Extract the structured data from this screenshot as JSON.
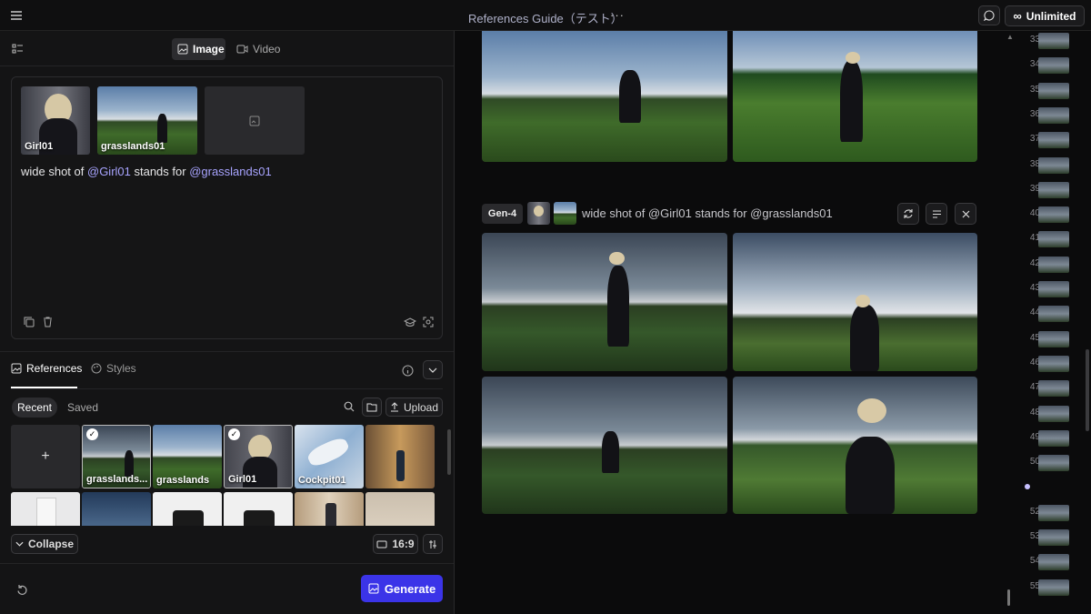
{
  "header": {
    "title": "References Guide（テスト）",
    "more_label": "···",
    "plan_label": "Unlimited"
  },
  "mode_tabs": [
    {
      "label": "Image",
      "active": true
    },
    {
      "label": "Video",
      "active": false
    }
  ],
  "prompt": {
    "attachments": [
      "Girl01",
      "grasslands01"
    ],
    "text_before": "wide shot of ",
    "mention1": "@Girl01",
    "text_middle": " stands for ",
    "mention2": "@grasslands01"
  },
  "refs_panel": {
    "tabs": [
      "References",
      "Styles"
    ],
    "filters": [
      "Recent",
      "Saved"
    ],
    "upload_label": "Upload",
    "add_label": "+",
    "grid_row1": [
      {
        "label": "grasslands...",
        "checked": true
      },
      {
        "label": "grasslands",
        "checked": false
      },
      {
        "label": "Girl01",
        "checked": true
      },
      {
        "label": "Cockpit01",
        "checked": false
      },
      {
        "label": "",
        "checked": false
      }
    ],
    "collapse_label": "Collapse",
    "ratio_label": "16:9",
    "generate_label": "Generate"
  },
  "generation": {
    "model_badge": "Gen-4",
    "prompt_text": "wide shot of @Girl01 stands for @grasslands01"
  },
  "timeline": {
    "numbers": [
      "33",
      "34",
      "35",
      "36",
      "37",
      "38",
      "39",
      "40",
      "41",
      "42",
      "43",
      "44",
      "45",
      "46",
      "47",
      "48",
      "49",
      "50",
      "",
      "52",
      "53",
      "54",
      "55"
    ]
  },
  "colors": {
    "accent": "#3b34e8",
    "mention": "#a8a4ff"
  }
}
